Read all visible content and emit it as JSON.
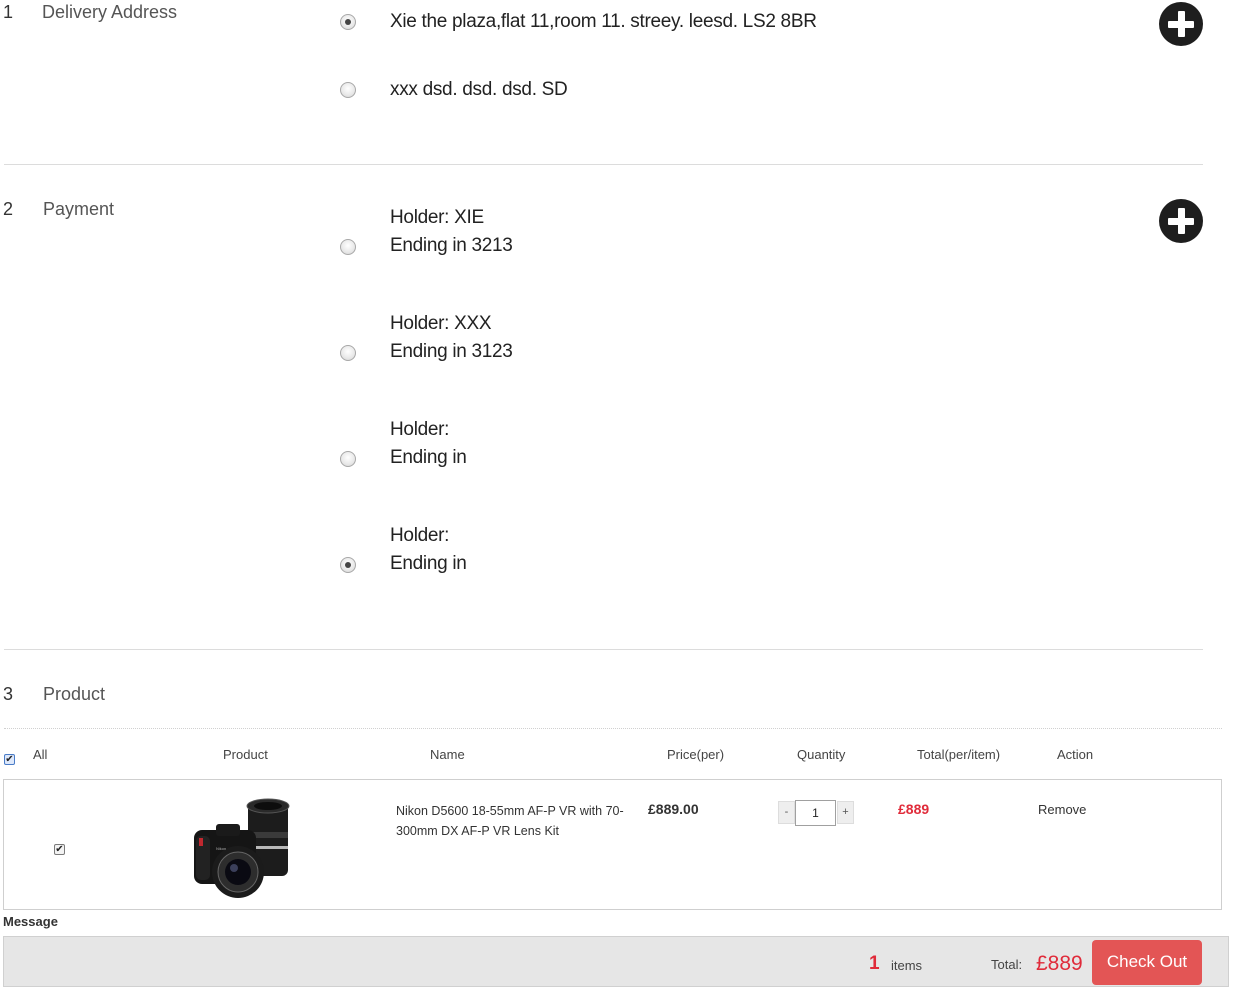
{
  "sections": {
    "delivery": {
      "num": "1",
      "title": "Delivery Address"
    },
    "payment": {
      "num": "2",
      "title": "Payment"
    },
    "product": {
      "num": "3",
      "title": "Product"
    }
  },
  "addresses": [
    {
      "text": "Xie the plaza,flat 11,room 11. streey. leesd. LS2 8BR",
      "selected": true
    },
    {
      "text": "xxx dsd. dsd. dsd. SD",
      "selected": false
    }
  ],
  "payments": [
    {
      "holder": "Holder: XIE",
      "ending": "Ending in 3213",
      "selected": false
    },
    {
      "holder": "Holder: XXX",
      "ending": "Ending in 3123",
      "selected": false
    },
    {
      "holder": "Holder:",
      "ending": "Ending in",
      "selected": false
    },
    {
      "holder": "Holder:",
      "ending": "Ending in",
      "selected": true
    }
  ],
  "table": {
    "headers": {
      "all": "All",
      "product": "Product",
      "name": "Name",
      "price": "Price(per)",
      "quantity": "Quantity",
      "total": "Total(per/item)",
      "action": "Action"
    },
    "rows": [
      {
        "name": "Nikon D5600 18-55mm AF-P VR with 70-300mm DX AF-P VR Lens Kit",
        "price": "£889.00",
        "qty_minus": "-",
        "quantity": "1",
        "qty_plus": "+",
        "total": "£889",
        "action": "Remove",
        "checked": true
      }
    ]
  },
  "message_label": "Message",
  "footer": {
    "count": "1",
    "items_label": "items",
    "total_label": "Total:",
    "total_value": "£889",
    "checkout_label": "Check Out"
  },
  "colors": {
    "accent_red": "#e02b3a",
    "checkout_bg": "#e35555",
    "plus_icon": "#1e1e1e"
  }
}
